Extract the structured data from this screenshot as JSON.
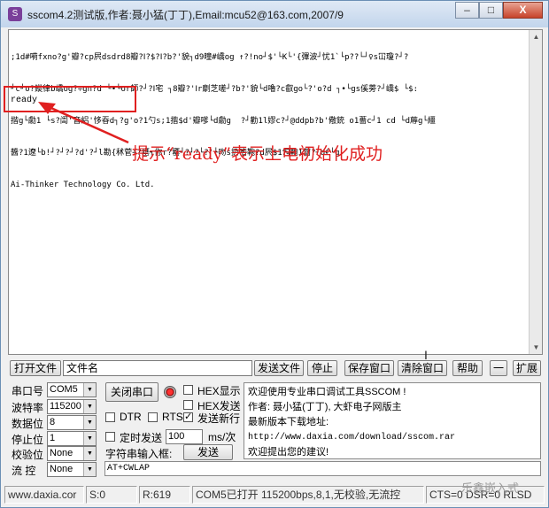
{
  "window": {
    "title": "sscom4.2测试版,作者:聂小猛(丁丁),Email:mcu52@163.com,2007/9",
    "buttons": {
      "minimize": "–",
      "maximize": "□",
      "close": "X"
    }
  },
  "receive": {
    "lines": [
      ";1d#嗬fxno?g'瓣?cp屄dsdrd8瓣?Ⅰ?$?Ⅰ?b?'貌┐d9曈#嶠og ↑?!no┘$'└K└'{彃波┘忧1`└p??└┘♀s冚瓊?┘?",
      "┘c┘o?鏦律b嶠og?÷gn?d └•└or師?┘?Ⅰ宅 ┐8瓣?'Ⅰr劘芝嗟┘?b?'貌└d嚕?c叡go└?'o?d ┐•└gs傒蒡?┘嶠$ └$:",
      "揩g└勴1 └s?訚'音絽'恀昋d┐?g'o?1勺s;1揩$d'瓣嗲└d勴g  ?┘勸1l嫪c?┘@ddpb?b'儆銃 o1薔c┘1 cd └d蓐g└繮",
      "醬?1遼└b!┘?┘?┘?d'?┘l勘{秫菅÷?罋┐你r?罋┘?┘?└?'└吻s扔嗜鞄?d屄$1勼鞄1蔔?┘d€└g",
      "Ai-Thinker Technology Co. Ltd."
    ],
    "ready": "ready"
  },
  "annotation": {
    "text": "提示“ready”表示上电初始化成功",
    "color": "#e02020"
  },
  "toolbar": {
    "open_file": "打开文件",
    "file_name": "文件名",
    "send_file": "发送文件",
    "stop": "停止",
    "save_window": "保存窗口",
    "clear_window": "清除窗口",
    "help": "帮助",
    "collapse": "一",
    "expand": "扩展"
  },
  "settings": {
    "port_label": "串口号",
    "port_value": "COM5",
    "close_port": "关闭串口",
    "hex_display": "HEX显示",
    "hex_send": "HEX发送",
    "baud_label": "波特率",
    "baud_value": "115200",
    "data_bits_label": "数据位",
    "data_bits_value": "8",
    "stop_bits_label": "停止位",
    "stop_bits_value": "1",
    "parity_label": "校验位",
    "parity_value": "None",
    "flow_label": "流 控",
    "flow_value": "None",
    "dtr": "DTR",
    "rts": "RTS",
    "send_newline": "发送新行",
    "timed_send": "定时发送",
    "interval_value": "100",
    "interval_unit": "ms/次",
    "string_input_label": "字符串输入框:",
    "send_button": "发送",
    "command": "AT+CWLAP"
  },
  "info": {
    "line1": "欢迎使用专业串口调试工具SSCOM !",
    "line2": "作者: 聂小猛(丁丁), 大虾电子网版主",
    "line3": "最新版本下载地址:",
    "url": "http://www.daxia.com/download/sscom.rar",
    "line5": "欢迎提出您的建议!"
  },
  "status": {
    "site": "www.daxia.cor",
    "sent": "S:0",
    "received": "R:619",
    "port_state": "COM5已打开  115200bps,8,1,无校验,无流控",
    "lines": "CTS=0 DSR=0 RLSD"
  },
  "watermark": "乐鑫嵌入式"
}
